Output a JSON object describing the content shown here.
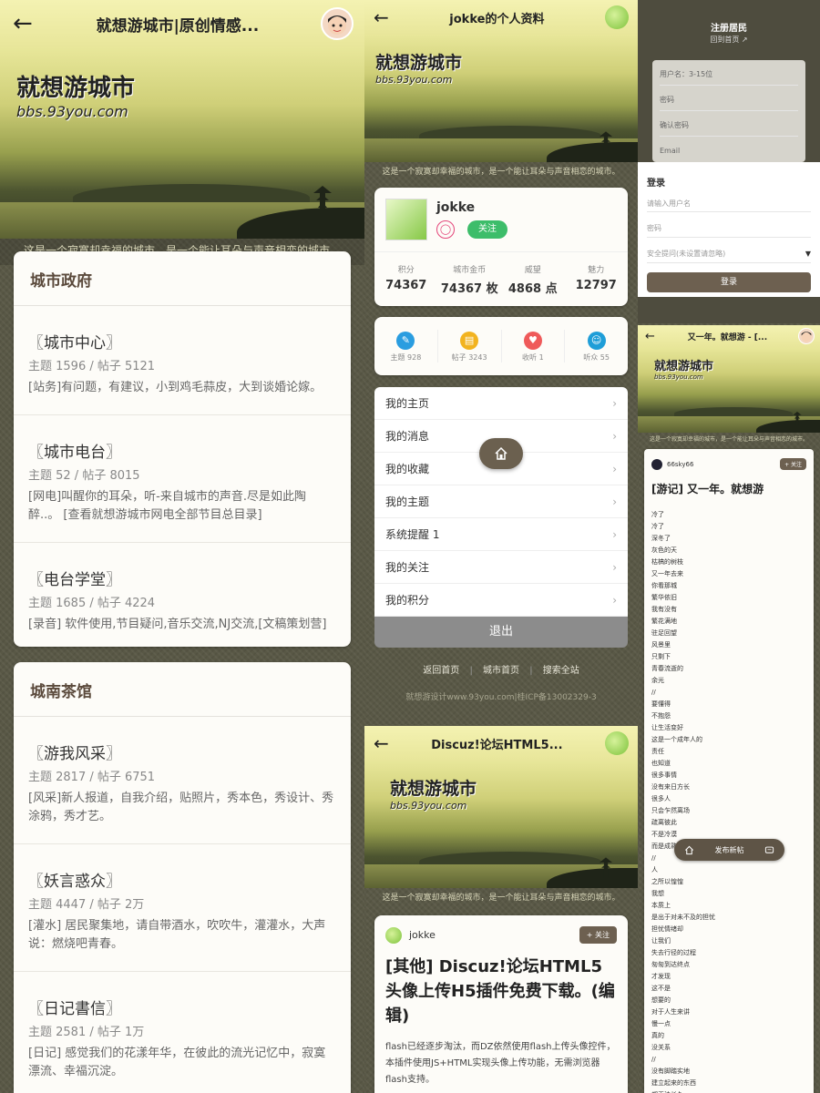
{
  "p1": {
    "header_title": "就想游城市|原创情感...",
    "logo": "就想游城市",
    "logo_url": "bbs.93you.com",
    "slogan": "这是一个寂寞却幸福的城市，是一个能让耳朵与声音相恋的城市。",
    "sections": [
      {
        "title": "城市政府",
        "forums": [
          {
            "name": "〖城市中心〗",
            "meta": "主题 1596 / 帖子 5121",
            "desc": "[站务]有问题，有建议，小到鸡毛蒜皮，大到谈婚论嫁。"
          },
          {
            "name": "〖城市电台〗",
            "meta": "主题 52 / 帖子 8015",
            "desc": "[网电]叫醒你的耳朵，听-来自城市的声音.尽是如此陶醉..。 [查看就想游城市网电全部节目总目录]"
          },
          {
            "name": "〖电台学堂〗",
            "meta": "主题 1685 / 帖子 4224",
            "desc": "[录音] 软件使用,节目疑问,音乐交流,NJ交流,[文稿策划营]"
          }
        ]
      },
      {
        "title": "城南茶馆",
        "forums": [
          {
            "name": "〖游我风采〗",
            "meta": "主题 2817 / 帖子 6751",
            "desc": "[风采]新人报道，自我介绍，贴照片，秀本色，秀设计、秀涂鸦，秀才艺。"
          },
          {
            "name": "〖妖言惑众〗",
            "meta": "主题 4447 / 帖子 2万",
            "desc": "[灌水] 居民聚集地，请自带酒水，吹吹牛，灌灌水，大声说：燃烧吧青春。"
          },
          {
            "name": "〖日记書信〗",
            "meta": "主题 2581 / 帖子 1万",
            "desc": "[日记] 感觉我们的花漾年华，在彼此的流光记忆中，寂寞漂流、幸福沉淀。"
          }
        ]
      }
    ]
  },
  "p2": {
    "header_title": "jokke的个人资料",
    "logo": "就想游城市",
    "logo_url": "bbs.93you.com",
    "slogan": "这是一个寂寞却幸福的城市，是一个能让耳朵与声音相恋的城市。",
    "username": "jokke",
    "follow": "关注",
    "stats": [
      {
        "label": "积分",
        "value": "74367"
      },
      {
        "label": "城市金币",
        "value": "74367 枚"
      },
      {
        "label": "威望",
        "value": "4868 点"
      },
      {
        "label": "魅力",
        "value": "12797"
      }
    ],
    "counts": [
      {
        "label": "主题 928",
        "color": "#2a9de0",
        "glyph": "✎"
      },
      {
        "label": "帖子 3243",
        "color": "#f2b320",
        "glyph": "▤"
      },
      {
        "label": "收听 1",
        "color": "#ef5a5a",
        "glyph": "♥"
      },
      {
        "label": "听众 55",
        "color": "#1f9ed8",
        "glyph": "☺"
      }
    ],
    "menu": [
      "我的主页",
      "我的消息",
      "我的收藏",
      "我的主题",
      "系统提醒 1",
      "我的关注",
      "我的积分"
    ],
    "logout": "退出",
    "footer_links": [
      "返回首页",
      "城市首页",
      "搜索全站"
    ],
    "copyright": "就想游设计www.93you.com|桂ICP备13002329-3"
  },
  "p3": {
    "register_title": "注册居民",
    "back_home": "回到首页",
    "reg_fields": [
      "用户名：3-15位",
      "密码",
      "确认密码",
      "Email"
    ],
    "login_title": "登录",
    "login_fields": [
      "请输入用户名",
      "密码"
    ],
    "security_select": "安全提问(未设置请忽略)",
    "login_button": "登录"
  },
  "p4": {
    "header_title": "Discuz!论坛HTML5...",
    "logo": "就想游城市",
    "logo_url": "bbs.93you.com",
    "slogan": "这是一个寂寞却幸福的城市，是一个能让耳朵与声音相恋的城市。",
    "author": "jokke",
    "follow": "+ 关注",
    "post_title": "[其他] Discuz!论坛HTML5头像上传H5插件免费下载。(编辑)",
    "body": "flash已经逐步淘汰，而DZ依然使用flash上传头像控件，本插件使用JS+HTML实现头像上传功能，无需浏览器flash支持。"
  },
  "p5": {
    "header_title": "又一年。就想游 - [...",
    "logo": "就想游城市",
    "logo_url": "bbs.93you.com",
    "slogan": "这是一个寂寞却幸福的城市，是一个能让耳朵与声音相恋的城市。",
    "author": "66sky66",
    "follow": "+ 关注",
    "post_title": "[游记] 又一年。就想游",
    "poem": [
      "冷了",
      "冷了",
      "深冬了",
      "灰色的天",
      "枯槁的树枝",
      "又一年去来",
      "你看那城",
      "繁华依旧",
      "我有没有",
      "繁花满地",
      "驻足回望",
      "风景里",
      "只剩下",
      "青春流逝的",
      "余光",
      "//",
      "要懂得",
      "不抱怨",
      "让生活变好",
      "这是一个成年人的",
      "责任",
      "也知道",
      "很多事情",
      "没有来日方长",
      "很多人",
      "只会乍然离场",
      "疏离彼此",
      "不是冷漠",
      "而是成熟",
      "//",
      "人",
      "之所以惶惶",
      "我想",
      "本质上",
      "是出于对未不及的担忧",
      "担忧情绪却",
      "让我们",
      "失去行径的过程",
      "匆匆到达终点",
      "才发现",
      "这不是",
      "想要的",
      "对于人生来讲",
      "慢一点",
      "真的",
      "没关系",
      "//",
      "没有脚踏实地",
      "建立起来的东西",
      "都无法长久"
    ],
    "post_new": "发布新帖"
  }
}
